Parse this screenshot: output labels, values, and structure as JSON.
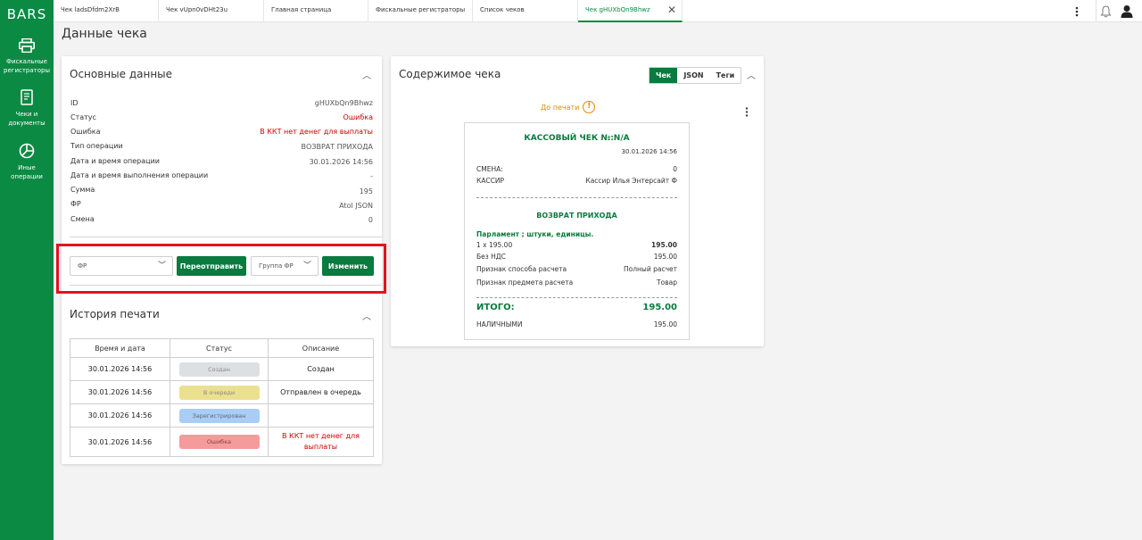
{
  "brand": "BARS",
  "sidebar": {
    "items": [
      {
        "label": "Фискальные регистраторы",
        "icon": "printer-icon"
      },
      {
        "label": "Чеки и документы",
        "icon": "document-icon"
      },
      {
        "label": "Иные операции",
        "icon": "pie-chart-icon"
      }
    ]
  },
  "tabs": [
    {
      "label": "Чек ladsDfdm2XrB"
    },
    {
      "label": "Чек vUpn0vDHt23u"
    },
    {
      "label": "Главная страница"
    },
    {
      "label": "Фискальные регистраторы"
    },
    {
      "label": "Список чеков"
    },
    {
      "label": "Чек gHUXbQn9Bhwz",
      "active": true
    }
  ],
  "page_title": "Данные чека",
  "basic": {
    "title": "Основные данные",
    "rows": [
      {
        "label": "ID",
        "value": "gHUXbQn9Bhwz"
      },
      {
        "label": "Статус",
        "value": "Ошибка"
      },
      {
        "label": "Ошибка",
        "value": "В ККТ нет денег для выплаты"
      },
      {
        "label": "Тип операции",
        "value": "ВОЗВРАТ ПРИХОДА"
      },
      {
        "label": "Дата и время операции",
        "value": "30.01.2026 14:56"
      },
      {
        "label": "Дата и время выполнения операции",
        "value": "-"
      },
      {
        "label": "Сумма",
        "value": "195"
      },
      {
        "label": "ФР",
        "value": "Atol JSON"
      },
      {
        "label": "Смена",
        "value": "0"
      }
    ]
  },
  "actions": {
    "fr_placeholder": "ФР",
    "resend_label": "Переотправить",
    "group_placeholder": "Группа ФР",
    "change_label": "Изменить"
  },
  "history": {
    "title": "История печати",
    "columns": [
      "Время и дата",
      "Статус",
      "Описание"
    ],
    "rows": [
      {
        "time": "30.01.2026 14:56",
        "status": "Создан",
        "desc": "Создан"
      },
      {
        "time": "30.01.2026 14:56",
        "status": "В очереди",
        "desc": "Отправлен в очередь"
      },
      {
        "time": "30.01.2026 14:56",
        "status": "Зарегистрирован",
        "desc": ""
      },
      {
        "time": "30.01.2026 14:56",
        "status": "Ошибка",
        "desc": "В ККТ нет денег для выплаты"
      }
    ],
    "status_colors": {
      "Создан": "#d9dde0",
      "В очереди": "#ebe08f",
      "Зарегистрирован": "#a9cdf5",
      "Ошибка": "#f59b9b"
    }
  },
  "content": {
    "title": "Содержимое чека",
    "views": [
      "Чек",
      "JSON",
      "Теги"
    ],
    "active_view": "Чек",
    "pre_print": "До печати"
  },
  "receipt": {
    "title": "КАССОВЫЙ ЧЕК №:N/A",
    "date": "30.01.2026 14:56",
    "shift_label": "СМЕНА:",
    "shift_value": "0",
    "cashier_label": "КАССИР",
    "cashier_value": "Кассир Илья Энтерсайт Ф",
    "operation": "ВОЗВРАТ ПРИХОДА",
    "item_name": "Парламент ; штуки, единицы.",
    "qty_price": "1 x 195.00",
    "item_total": "195.00",
    "vat_label": "Без НДС",
    "vat_value": "195.00",
    "pay_method_label": "Признак способа расчета",
    "pay_method_value": "Полный расчет",
    "subject_label": "Признак предмета расчета",
    "subject_value": "Товар",
    "total_label": "ИТОГО:",
    "total_value": "195.00",
    "cash_label": "НАЛИЧНЫМИ",
    "cash_value": "195.00"
  },
  "colors": {
    "primary": "#0b8a43",
    "error": "#d00000",
    "warning": "#e08a00",
    "highlight": "#e0141e"
  }
}
